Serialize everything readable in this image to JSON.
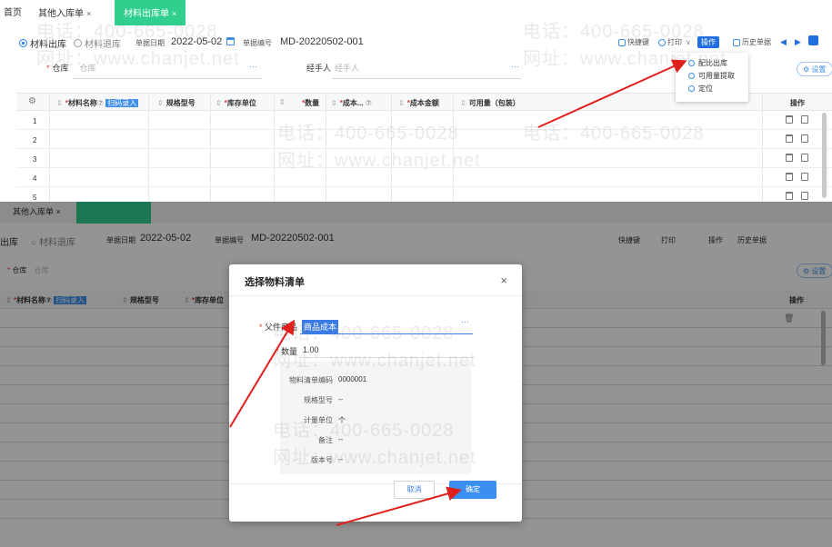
{
  "tabs": [
    {
      "label": "首页",
      "close": ""
    },
    {
      "label": "其他入库单",
      "close": "×"
    },
    {
      "label": "材料出库单",
      "close": "×"
    }
  ],
  "header": {
    "radio_out": "材料出库",
    "radio_return": "材料退库",
    "date_label": "单据日期",
    "date_value": "2022-05-02",
    "code_label": "单据编号",
    "code_value": "MD-20220502-001"
  },
  "toolbar": {
    "shortcut": "快捷键",
    "print": "打印",
    "operate": "操作",
    "history": "历史单据",
    "prev": "◀",
    "next": "▶"
  },
  "form": {
    "warehouse_label": "仓库",
    "warehouse_placeholder": "仓库",
    "handler_label": "经手人",
    "handler_placeholder": "经手人",
    "settings": "设置",
    "dots": "···"
  },
  "dropdown": {
    "items": [
      "配比出库",
      "可用量提取",
      "定位"
    ]
  },
  "grid": {
    "headers": {
      "material": "材料名称",
      "scan": "扫码录入",
      "spec": "规格型号",
      "unit": "库存单位",
      "qty": "数量",
      "cost": "成本...",
      "amount": "成本金额",
      "avail": "可用量（包装）",
      "ops": "操作"
    },
    "rows": [
      "1",
      "2",
      "3",
      "4",
      "5"
    ]
  },
  "bottom": {
    "tab_frag": "其他入库单 ×",
    "radio_out": "出库",
    "radio_return": "材料退库",
    "date_label": "单据日期",
    "date_value": "2022-05-02",
    "code_label": "单据编号",
    "code_value": "MD-20220502-001",
    "warehouse_label": "仓库",
    "warehouse_placeholder": "仓库",
    "ops": "操作",
    "settings": "设置",
    "shortcut": "快捷键",
    "print": "打印",
    "operate": "操作",
    "history": "历史单据",
    "headers": {
      "material": "材料名称",
      "scan": "扫码录入",
      "spec": "规格型号",
      "unit": "库存单位"
    }
  },
  "modal": {
    "title": "选择物料清单",
    "close": "×",
    "parent_label": "父件商品",
    "parent_value": "商品成本",
    "qty_label": "数量",
    "qty_value": "1.00",
    "dots": "···",
    "info": [
      {
        "label": "物料清单编码",
        "value": "0000001"
      },
      {
        "label": "规格型号",
        "value": "--"
      },
      {
        "label": "计量单位",
        "value": "个"
      },
      {
        "label": "备注",
        "value": "--"
      },
      {
        "label": "版本号",
        "value": "--"
      }
    ],
    "cancel": "取消",
    "ok": "确定"
  },
  "watermark": {
    "phone": "电话：400-665-0028",
    "site": "网址：www.chanjet.net"
  },
  "colors": {
    "green_tab": "#2fcf8d",
    "primary": "#3b7be6",
    "arrow": "#e0201c",
    "required": "#e23b3b"
  }
}
